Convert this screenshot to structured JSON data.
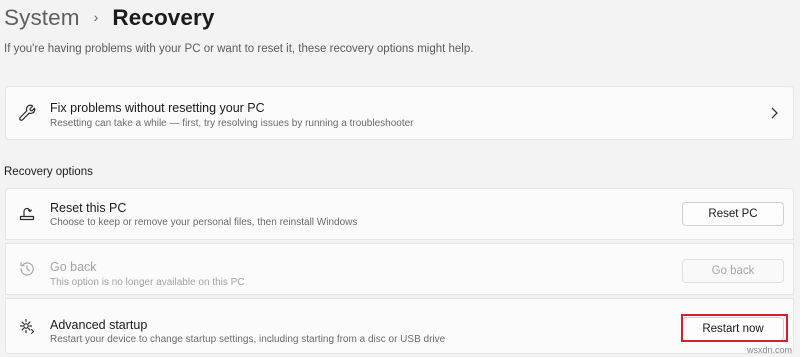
{
  "breadcrumb": {
    "parent": "System",
    "separator": "›",
    "current": "Recovery"
  },
  "page_description": "If you're having problems with your PC or want to reset it, these recovery options might help.",
  "fix_card": {
    "title": "Fix problems without resetting your PC",
    "subtitle": "Resetting can take a while — first, try resolving issues by running a troubleshooter",
    "icon": "wrench-icon"
  },
  "recovery_options": {
    "label": "Recovery options",
    "items": [
      {
        "title": "Reset this PC",
        "subtitle": "Choose to keep or remove your personal files, then reinstall Windows",
        "button": "Reset PC",
        "icon": "reset-pc-icon",
        "enabled": true
      },
      {
        "title": "Go back",
        "subtitle": "This option is no longer available on this PC",
        "button": "Go back",
        "icon": "history-icon",
        "enabled": false
      },
      {
        "title": "Advanced startup",
        "subtitle": "Restart your device to change startup settings, including starting from a disc or USB drive",
        "button": "Restart now",
        "icon": "gear-restart-icon",
        "enabled": true
      }
    ]
  },
  "highlight_color": "#d6212a",
  "watermark": "wsxdn.com"
}
